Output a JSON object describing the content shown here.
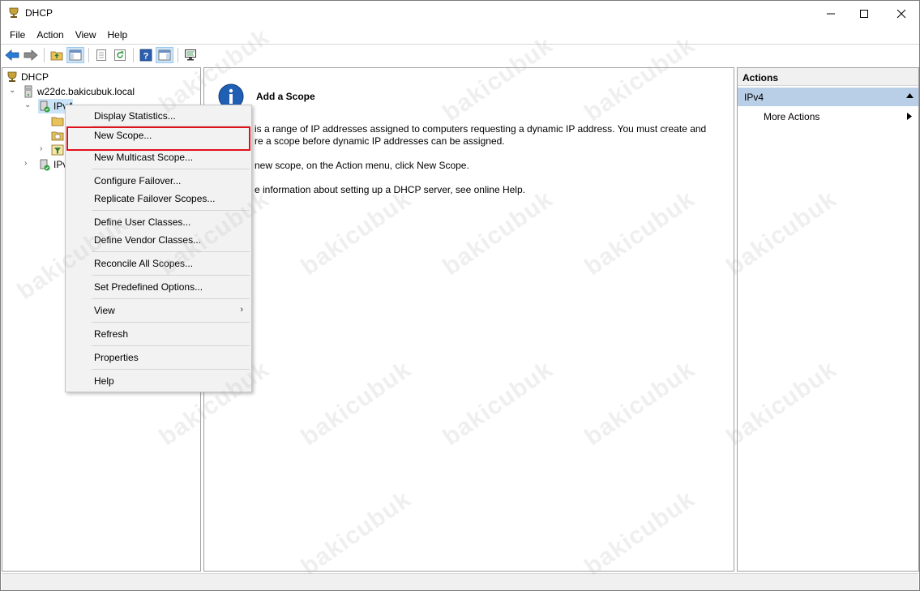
{
  "window": {
    "title": "DHCP"
  },
  "menubar": {
    "items": [
      "File",
      "Action",
      "View",
      "Help"
    ]
  },
  "tree": {
    "root": "DHCP",
    "server": "w22dc.bakicubuk.local",
    "ipv4": "IPv4",
    "ipv6": "IPv"
  },
  "center": {
    "heading": "Add a Scope",
    "line1": "is a range of IP addresses assigned to computers requesting a dynamic IP address. You must create and",
    "line2": "re a scope before dynamic IP addresses can be assigned.",
    "line3": "new scope, on the Action menu, click New Scope.",
    "line4": "e information about setting up a DHCP server, see online Help."
  },
  "actions": {
    "header": "Actions",
    "section": "IPv4",
    "more": "More Actions"
  },
  "context_menu": {
    "items": [
      "Display Statistics...",
      "New Scope...",
      "New Multicast Scope...",
      "Configure Failover...",
      "Replicate Failover Scopes...",
      "Define User Classes...",
      "Define Vendor Classes...",
      "Reconcile All Scopes...",
      "Set Predefined Options...",
      "View",
      "Refresh",
      "Properties",
      "Help"
    ],
    "highlighted": "New Scope...",
    "highlight_color": "#e0101a"
  },
  "watermark": {
    "text": "bakicubuk"
  },
  "colors": {
    "selection": "#b9cfe7",
    "accent_blue": "#1f5fb4"
  }
}
